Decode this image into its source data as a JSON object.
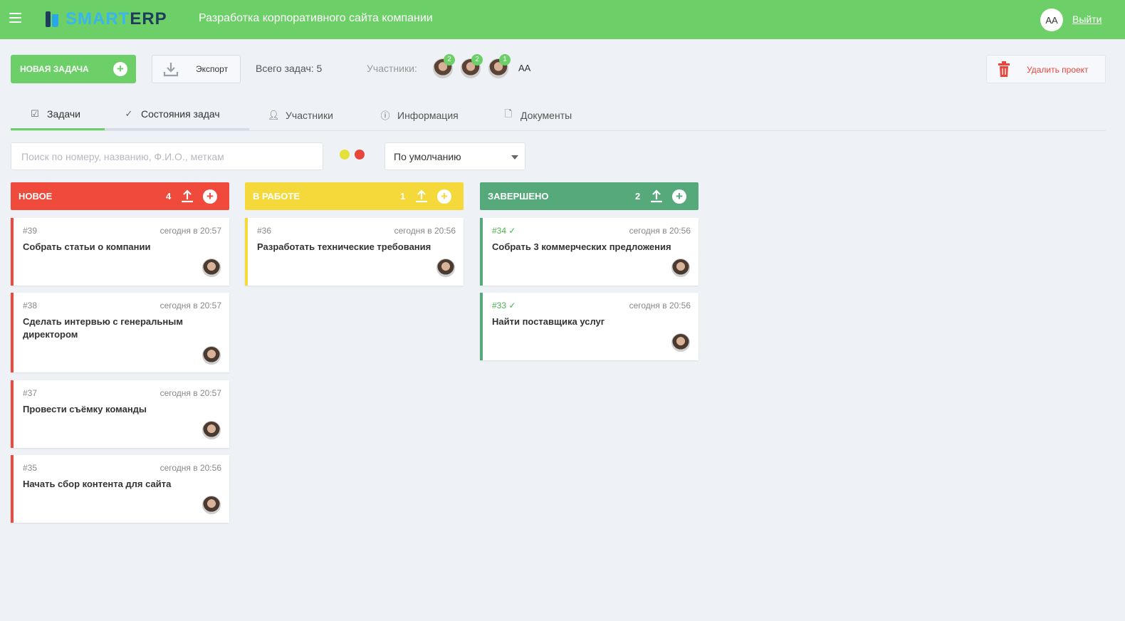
{
  "header": {
    "logo_part1": "SMART",
    "logo_part2": "ERP",
    "project_title": "Разработка корпоративного сайта компании",
    "user_initials": "AA",
    "logout_label": "Выйти"
  },
  "toolbar": {
    "new_task_label": "НОВАЯ ЗАДАЧА",
    "export_label": "Экспорт",
    "total_tasks": "Всего задач: 5",
    "members_label": "Участники:",
    "members": [
      {
        "badge": "2"
      },
      {
        "badge": "2"
      },
      {
        "badge": "1"
      }
    ],
    "member_initials": "AA",
    "delete_project_label": "Удалить проект"
  },
  "tabs": [
    {
      "label": "Задачи",
      "icon": "checkbox-icon"
    },
    {
      "label": "Состояния задач",
      "icon": "check-icon"
    },
    {
      "label": "Участники",
      "icon": "user-icon"
    },
    {
      "label": "Информация",
      "icon": "info-icon"
    },
    {
      "label": "Документы",
      "icon": "document-icon"
    }
  ],
  "filters": {
    "search_placeholder": "Поиск по номеру, названию, Ф.И.О., меткам",
    "sort_value": "По умолчанию",
    "dot_colors": [
      "#e6e13a",
      "#e8463c"
    ]
  },
  "columns": [
    {
      "name": "НОВОЕ",
      "count": "4",
      "color": "#ef4a3c",
      "cards": [
        {
          "num": "#39",
          "time": "сегодня в 20:57",
          "title": "Собрать статьи о компании"
        },
        {
          "num": "#38",
          "time": "сегодня в 20:57",
          "title": "Сделать интервью с генеральным директором"
        },
        {
          "num": "#37",
          "time": "сегодня в 20:57",
          "title": "Провести съёмку команды"
        },
        {
          "num": "#35",
          "time": "сегодня в 20:56",
          "title": "Начать сбор контента для сайта"
        }
      ]
    },
    {
      "name": "В РАБОТЕ",
      "count": "1",
      "color": "#f5d83a",
      "cards": [
        {
          "num": "#36",
          "time": "сегодня в 20:56",
          "title": "Разработать технические требования"
        }
      ]
    },
    {
      "name": "ЗАВЕРШЕНО",
      "count": "2",
      "color": "#55a97a",
      "cards": [
        {
          "num": "#34 ✓",
          "time": "сегодня в 20:56",
          "title": "Собрать 3 коммерческих предложения"
        },
        {
          "num": "#33 ✓",
          "time": "сегодня в 20:56",
          "title": "Найти поставщика услуг"
        }
      ]
    }
  ]
}
